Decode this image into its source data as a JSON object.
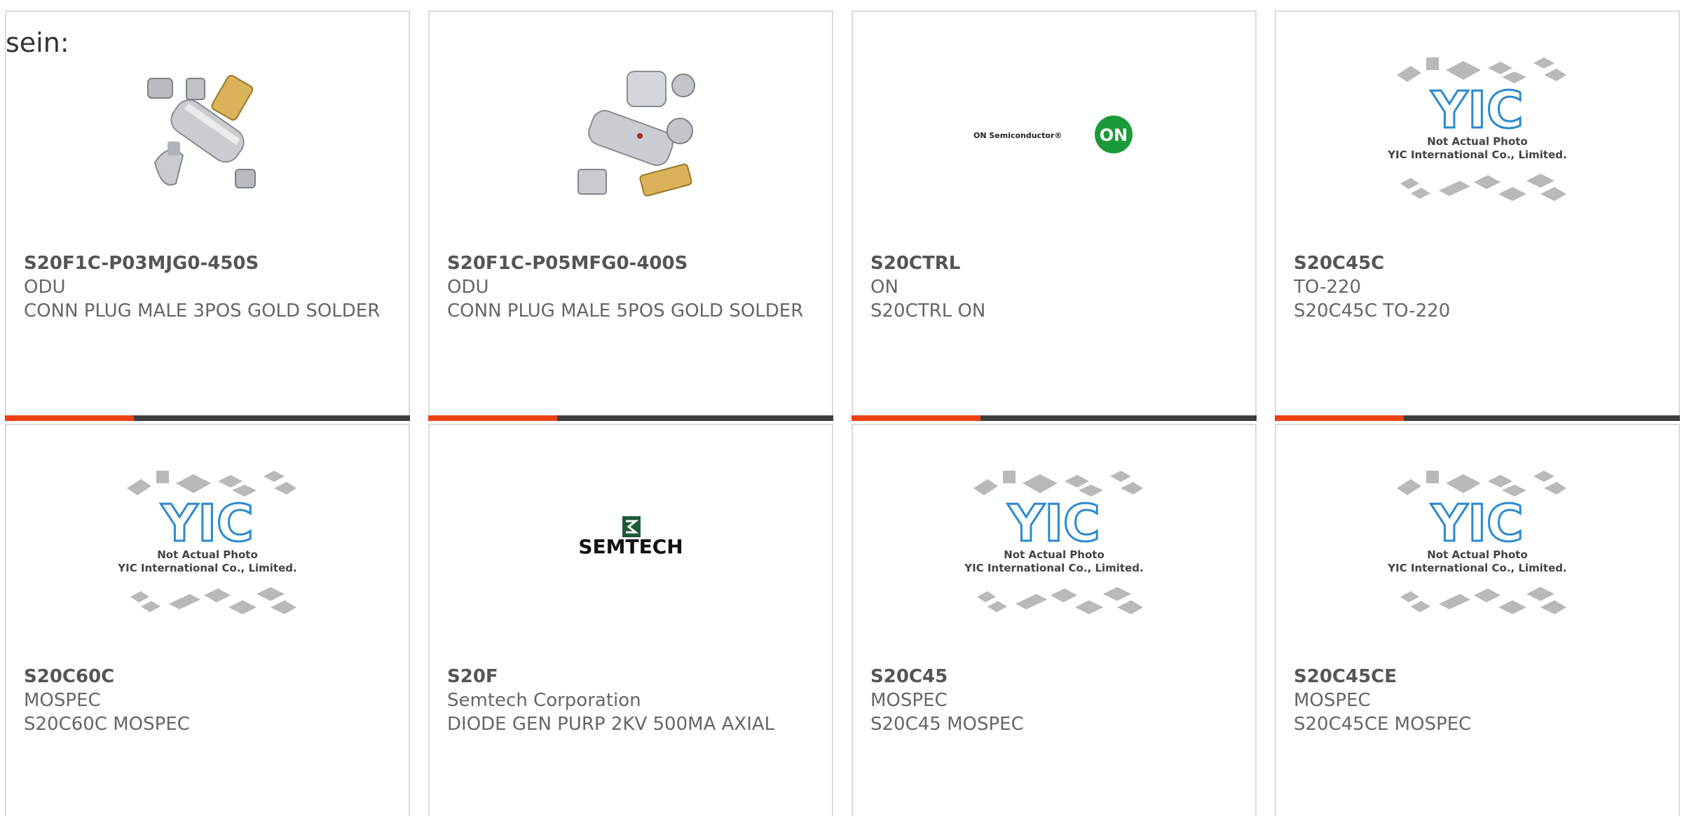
{
  "intro_text": "sein:",
  "products": [
    {
      "part": "S20F1C-P03MJG0-450S",
      "brand": "ODU",
      "desc": "CONN PLUG MALE 3POS GOLD SOLDER",
      "image": "connector-photo"
    },
    {
      "part": "S20F1C-P05MFG0-400S",
      "brand": "ODU",
      "desc": "CONN PLUG MALE 5POS GOLD SOLDER",
      "image": "connector-photo"
    },
    {
      "part": "S20CTRL",
      "brand": "ON",
      "desc": "S20CTRL ON",
      "image": "on-semiconductor-logo"
    },
    {
      "part": "S20C45C",
      "brand": "TO-220",
      "desc": "S20C45C TO-220",
      "image": "yic-placeholder"
    },
    {
      "part": "S20C60C",
      "brand": "MOSPEC",
      "desc": "S20C60C MOSPEC",
      "image": "yic-placeholder"
    },
    {
      "part": "S20F",
      "brand": "Semtech Corporation",
      "desc": "DIODE GEN PURP 2KV 500MA AXIAL",
      "image": "semtech-logo"
    },
    {
      "part": "S20C45",
      "brand": "MOSPEC",
      "desc": "S20C45 MOSPEC",
      "image": "yic-placeholder"
    },
    {
      "part": "S20C45CE",
      "brand": "MOSPEC",
      "desc": "S20C45CE MOSPEC",
      "image": "yic-placeholder"
    }
  ],
  "logos": {
    "on_brand_text": "ON Semiconductor®",
    "on_badge": "ON",
    "semtech": "SEMTECH",
    "yic_mark": "YIC",
    "yic_line1": "Not Actual Photo",
    "yic_line2": "YIC International Co., Limited."
  },
  "colors": {
    "accent": "#ee3f12",
    "bar_dark": "#3e3e3e",
    "on_green": "#1b9a3a",
    "yic_blue": "#2b8ad0"
  }
}
